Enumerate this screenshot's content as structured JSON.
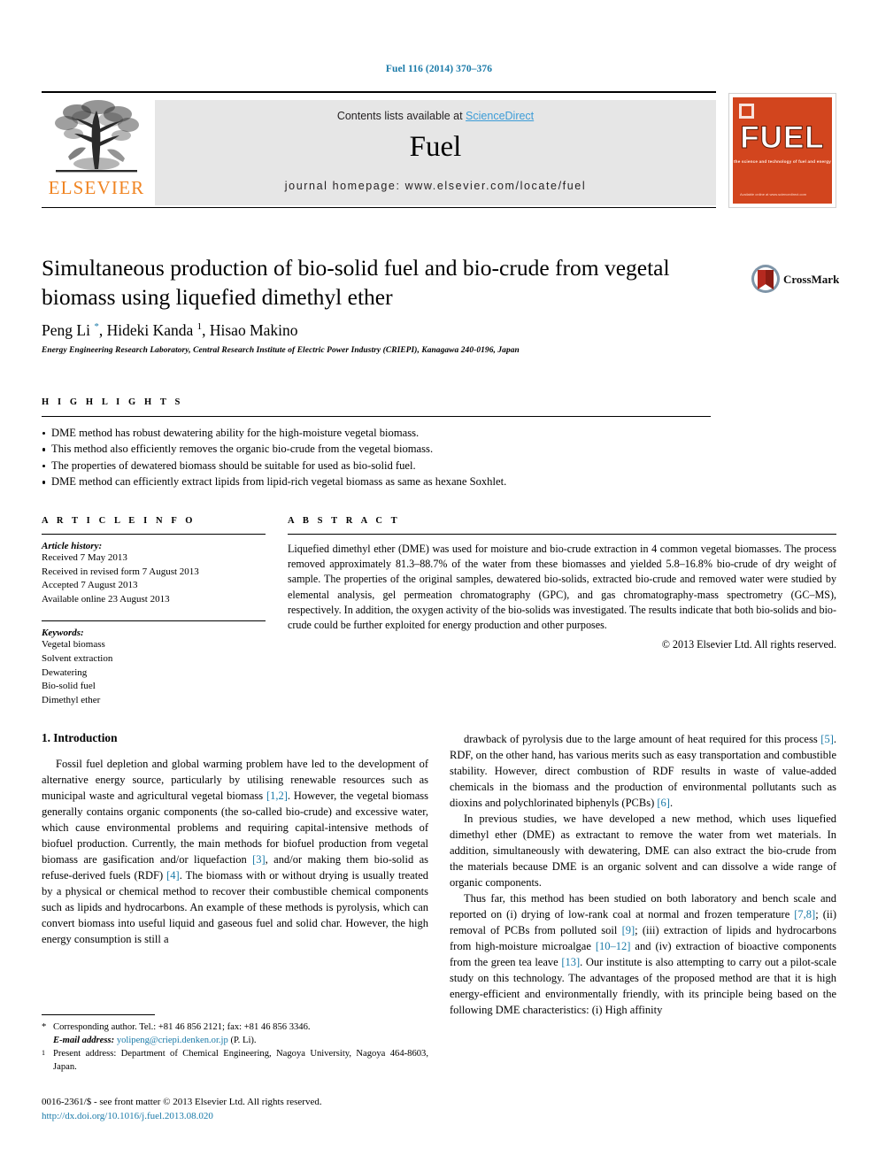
{
  "running_head": "Fuel 116 (2014) 370–376",
  "masthead": {
    "publisher": "ELSEVIER",
    "contents_prefix": "Contents lists available at ",
    "contents_link": "ScienceDirect",
    "journal_title": "Fuel",
    "homepage": "journal homepage: www.elsevier.com/locate/fuel",
    "cover": {
      "title": "FUEL",
      "subtitle": "the science and technology of fuel and energy",
      "footer": "Available online at www.sciencedirect.com"
    }
  },
  "article": {
    "title": "Simultaneous production of bio-solid fuel and bio-crude from vegetal biomass using liquefied dimethyl ether",
    "authors_html": "Peng Li <sup class=\"star\">*</sup>, Hideki Kanda <sup>1</sup>, Hisao Makino",
    "affiliation": "Energy Engineering Research Laboratory, Central Research Institute of Electric Power Industry (CRIEPI), Kanagawa 240-0196, Japan",
    "crossmark_label": "CrossMark"
  },
  "highlights": {
    "label": "H I G H L I G H T S",
    "items": [
      "DME method has robust dewatering ability for the high-moisture vegetal biomass.",
      "This method also efficiently removes the organic bio-crude from the vegetal biomass.",
      "The properties of dewatered biomass should be suitable for used as bio-solid fuel.",
      "DME method can efficiently extract lipids from lipid-rich vegetal biomass as same as hexane Soxhlet."
    ]
  },
  "article_info": {
    "label": "A R T I C L E   I N F O",
    "history_label": "Article history:",
    "history": [
      "Received 7 May 2013",
      "Received in revised form 7 August 2013",
      "Accepted 7 August 2013",
      "Available online 23 August 2013"
    ],
    "keywords_label": "Keywords:",
    "keywords": [
      "Vegetal biomass",
      "Solvent extraction",
      "Dewatering",
      "Bio-solid fuel",
      "Dimethyl ether"
    ]
  },
  "abstract": {
    "label": "A B S T R A C T",
    "text": "Liquefied dimethyl ether (DME) was used for moisture and bio-crude extraction in 4 common vegetal biomasses. The process removed approximately 81.3–88.7% of the water from these biomasses and yielded 5.8–16.8% bio-crude of dry weight of sample. The properties of the original samples, dewatered bio-solids, extracted bio-crude and removed water were studied by elemental analysis, gel permeation chromatography (GPC), and gas chromatography-mass spectrometry (GC–MS), respectively. In addition, the oxygen activity of the bio-solids was investigated. The results indicate that both bio-solids and bio-crude could be further exploited for energy production and other purposes.",
    "copyright": "© 2013 Elsevier Ltd. All rights reserved."
  },
  "body": {
    "section_heading": "1. Introduction",
    "left_paragraph_html": "Fossil fuel depletion and global warming problem have led to the development of alternative energy source, particularly by utilising renewable resources such as municipal waste and agricultural vegetal biomass <span class=\"ref\">[1,2]</span>. However, the vegetal biomass generally contains organic components (the so-called bio-crude) and excessive water, which cause environmental problems and requiring capital-intensive methods of biofuel production. Currently, the main methods for biofuel production from vegetal biomass are gasification and/or liquefaction <span class=\"ref\">[3]</span>, and/or making them bio-solid as refuse-derived fuels (RDF) <span class=\"ref\">[4]</span>. The biomass with or without drying is usually treated by a physical or chemical method to recover their combustible chemical components such as lipids and hydrocarbons. An example of these methods is pyrolysis, which can convert biomass into useful liquid and gaseous fuel and solid char. However, the high energy consumption is still a",
    "right_paragraphs_html": [
      "drawback of pyrolysis due to the large amount of heat required for this process <span class=\"ref\">[5]</span>. RDF, on the other hand, has various merits such as easy transportation and combustible stability. However, direct combustion of RDF results in waste of value-added chemicals in the biomass and the production of environmental pollutants such as dioxins and polychlorinated biphenyls (PCBs) <span class=\"ref\">[6]</span>.",
      "In previous studies, we have developed a new method, which uses liquefied dimethyl ether (DME) as extractant to remove the water from wet materials. In addition, simultaneously with dewatering, DME can also extract the bio-crude from the materials because DME is an organic solvent and can dissolve a wide range of organic components.",
      "Thus far, this method has been studied on both laboratory and bench scale and reported on (i) drying of low-rank coal at normal and frozen temperature <span class=\"ref\">[7,8]</span>; (ii) removal of PCBs from polluted soil <span class=\"ref\">[9]</span>; (iii) extraction of lipids and hydrocarbons from high-moisture microalgae <span class=\"ref\">[10–12]</span> and (iv) extraction of bioactive components from the green tea leave <span class=\"ref\">[13]</span>. Our institute is also attempting to carry out a pilot-scale study on this technology. The advantages of the proposed method are that it is high energy-efficient and environmentally friendly, with its principle being based on the following DME characteristics: (i) High affinity"
    ]
  },
  "footnotes": {
    "corresponding_html": "Corresponding author. Tel.: +81 46 856 2121; fax: +81 46 856 3346.",
    "email_label": "E-mail address:",
    "email": "yolipeng@criepi.denken.or.jp",
    "email_suffix": "(P. Li).",
    "present_address": "Present address: Department of Chemical Engineering, Nagoya University, Nagoya 464-8603, Japan.",
    "corresponding_marker": "*",
    "present_marker": "1"
  },
  "imprint": {
    "line": "0016-2361/$ - see front matter © 2013 Elsevier Ltd. All rights reserved.",
    "doi": "http://dx.doi.org/10.1016/j.fuel.2013.08.020"
  }
}
